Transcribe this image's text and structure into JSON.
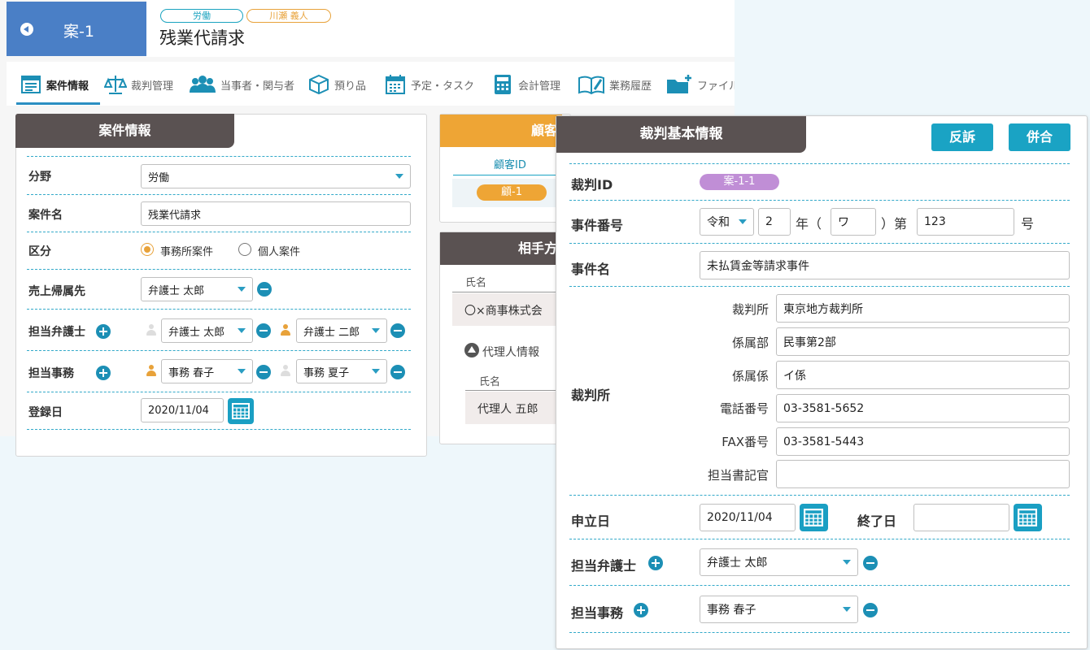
{
  "header": {
    "case_id": "案-1",
    "tags": [
      "労働",
      "川瀬 義人"
    ],
    "title": "残業代請求"
  },
  "tabs": [
    {
      "label": "案件情報",
      "icon": "case-info-icon"
    },
    {
      "label": "裁判管理",
      "icon": "scales-icon"
    },
    {
      "label": "当事者・関与者",
      "icon": "people-icon"
    },
    {
      "label": "預り品",
      "icon": "box-icon"
    },
    {
      "label": "予定・タスク",
      "icon": "calendar-icon"
    },
    {
      "label": "会計管理",
      "icon": "calculator-icon"
    },
    {
      "label": "業務履歴",
      "icon": "book-icon"
    },
    {
      "label": "ファイル",
      "icon": "folder-plus-icon"
    }
  ],
  "case_info": {
    "heading": "案件情報",
    "field_label": "分野",
    "field_value": "労働",
    "name_label": "案件名",
    "name_value": "残業代請求",
    "category_label": "区分",
    "category_options": [
      "事務所案件",
      "個人案件"
    ],
    "category_selected": "事務所案件",
    "sales_label": "売上帰属先",
    "sales_value": "弁護士 太郎",
    "lawyer_label": "担当弁護士",
    "lawyers": [
      "弁護士 太郎",
      "弁護士 二郎"
    ],
    "staff_label": "担当事務",
    "staff": [
      "事務 春子",
      "事務 夏子"
    ],
    "reg_date_label": "登録日",
    "reg_date": "2020/11/04"
  },
  "client_panel": {
    "heading": "顧客",
    "id_header": "顧客ID",
    "id_value": "顧-1"
  },
  "opponent_panel": {
    "heading": "相手方",
    "name_header": "氏名",
    "name_value": "〇×商事株式会",
    "agent_toggle": "代理人情報",
    "agent_name_header": "氏名",
    "agent_name_value": "代理人 五郎"
  },
  "trial": {
    "heading": "裁判基本情報",
    "counter_button": "反訴",
    "merge_button": "併合",
    "trial_id_label": "裁判ID",
    "trial_id": "案-1-1",
    "case_no_label": "事件番号",
    "era": "令和",
    "year": "2",
    "year_suffix": "年（",
    "symbol": "ワ",
    "no_prefix": "）第",
    "number": "123",
    "no_suffix": "号",
    "case_name_label": "事件名",
    "case_name": "未払賃金等請求事件",
    "court_label": "裁判所",
    "court_rows": [
      {
        "label": "裁判所",
        "value": "東京地方裁判所"
      },
      {
        "label": "係属部",
        "value": "民事第2部"
      },
      {
        "label": "係属係",
        "value": "イ係"
      },
      {
        "label": "電話番号",
        "value": "03-3581-5652"
      },
      {
        "label": "FAX番号",
        "value": "03-3581-5443"
      },
      {
        "label": "担当書記官",
        "value": ""
      }
    ],
    "filing_date_label": "申立日",
    "filing_date": "2020/11/04",
    "end_date_label": "終了日",
    "end_date": "",
    "lawyer_label": "担当弁護士",
    "lawyer_value": "弁護士 太郎",
    "staff_label": "担当事務",
    "staff_value": "事務 春子"
  },
  "colors": {
    "brand_blue": "#4a7fc6",
    "accent_teal": "#1aa3c4",
    "heading_dark": "#5a5252",
    "client_orange": "#eea535",
    "badge_purple": "#c08ed6"
  }
}
